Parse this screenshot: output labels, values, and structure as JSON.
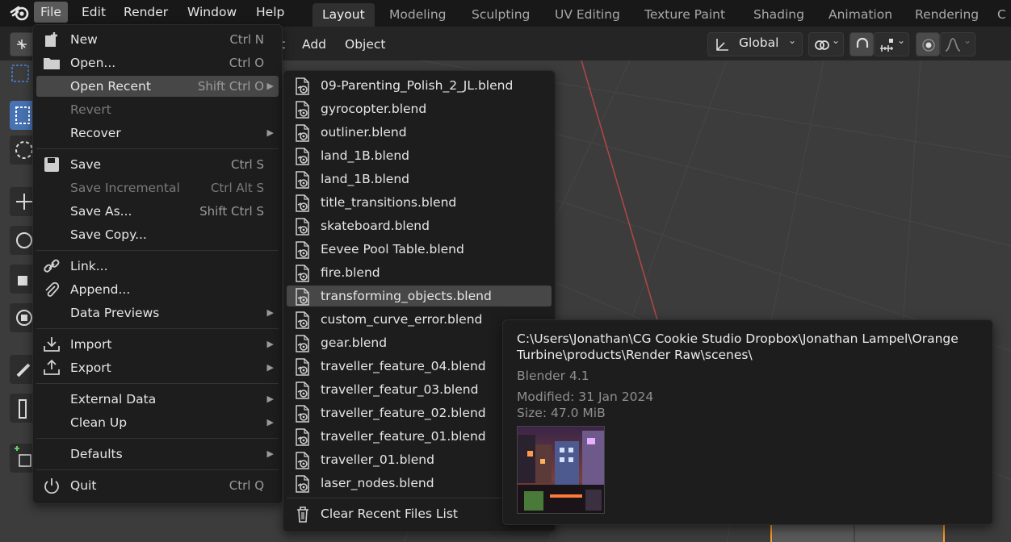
{
  "topbar": {
    "menus": [
      "File",
      "Edit",
      "Render",
      "Window",
      "Help"
    ],
    "workspaces": [
      "Layout",
      "Modeling",
      "Sculpting",
      "UV Editing",
      "Texture Paint",
      "Shading",
      "Animation",
      "Rendering",
      "C"
    ]
  },
  "viewport_header": {
    "add": "Add",
    "object": "Object",
    "transform_orientation": "Global",
    "cut_letter": "t"
  },
  "file_menu": {
    "items": [
      {
        "label": "New",
        "shortcut": "Ctrl N",
        "icon": "new-file-icon"
      },
      {
        "label": "Open...",
        "shortcut": "Ctrl O",
        "icon": "folder-icon"
      },
      {
        "label": "Open Recent",
        "shortcut": "Shift Ctrl O"
      },
      {
        "label": "Revert"
      },
      {
        "label": "Recover"
      },
      {
        "label": "Save",
        "shortcut": "Ctrl S",
        "icon": "save-icon"
      },
      {
        "label": "Save Incremental",
        "shortcut": "Ctrl Alt S"
      },
      {
        "label": "Save As...",
        "shortcut": "Shift Ctrl S"
      },
      {
        "label": "Save Copy..."
      },
      {
        "label": "Link...",
        "icon": "link-icon"
      },
      {
        "label": "Append...",
        "icon": "paperclip-icon"
      },
      {
        "label": "Data Previews"
      },
      {
        "label": "Import",
        "icon": "import-icon"
      },
      {
        "label": "Export",
        "icon": "export-icon"
      },
      {
        "label": "External Data"
      },
      {
        "label": "Clean Up"
      },
      {
        "label": "Defaults"
      },
      {
        "label": "Quit",
        "shortcut": "Ctrl Q",
        "icon": "power-icon"
      }
    ]
  },
  "recent_files": {
    "files": [
      "09-Parenting_Polish_2_JL.blend",
      "gyrocopter.blend",
      "outliner.blend",
      "land_1B.blend",
      "land_1B.blend",
      "title_transitions.blend",
      "skateboard.blend",
      "Eevee Pool Table.blend",
      "fire.blend",
      "transforming_objects.blend",
      "custom_curve_error.blend",
      "gear.blend",
      "traveller_feature_04.blend",
      "traveller_featur_03.blend",
      "traveller_feature_02.blend",
      "traveller_feature_01.blend",
      "traveller_01.blend",
      "laser_nodes.blend"
    ],
    "highlighted_index": 9,
    "clear_label": "Clear Recent Files List"
  },
  "tooltip": {
    "path_line1": "C:\\Users\\Jonathan\\CG Cookie Studio Dropbox\\Jonathan Lampel\\Orange",
    "path_line2": "Turbine\\products\\Render Raw\\scenes\\",
    "version": "Blender 4.1",
    "modified": "Modified: 31 Jan 2024",
    "size": "Size: 47.0 MiB"
  },
  "colors": {
    "accent": "#4772b3",
    "highlight": "#474747",
    "menu_bg": "#1d1d1d",
    "x_axis": "#b34747",
    "selection_outline": "#ff9a1f"
  }
}
